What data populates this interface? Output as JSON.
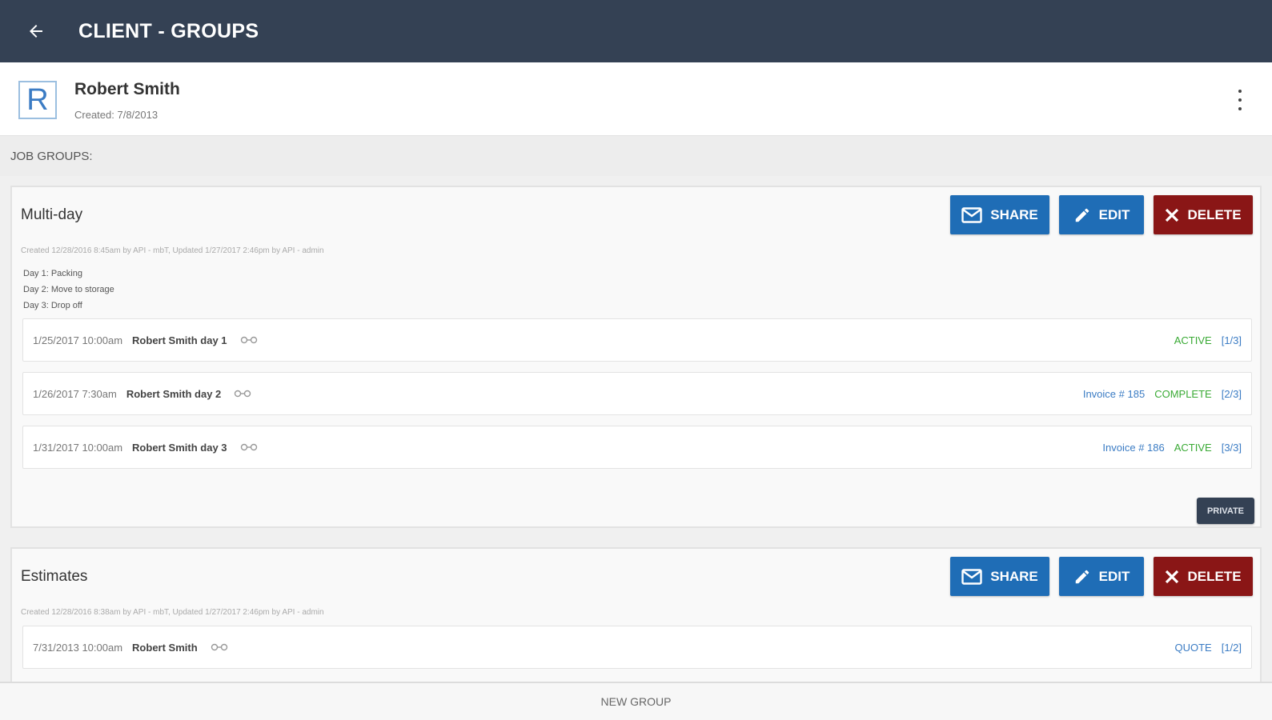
{
  "header": {
    "title": "CLIENT - GROUPS",
    "back_icon": "arrow-left-icon"
  },
  "client": {
    "initial": "R",
    "name": "Robert Smith",
    "created": "Created: 7/8/2013",
    "menu_icon": "more-vertical-icon"
  },
  "section_label": "JOB GROUPS:",
  "buttons": {
    "share": "SHARE",
    "edit": "EDIT",
    "delete": "DELETE"
  },
  "groups": [
    {
      "title": "Multi-day",
      "meta": "Created 12/28/2016 8:45am by API - mbT, Updated 1/27/2017 2:46pm by API - admin",
      "description": [
        "Day 1: Packing",
        "Day 2: Move to storage",
        "Day 3: Drop off"
      ],
      "jobs": [
        {
          "date": "1/25/2017 10:00am",
          "name": "Robert Smith day 1",
          "invoice": "",
          "status": "ACTIVE",
          "count": "[1/3]"
        },
        {
          "date": "1/26/2017 7:30am",
          "name": "Robert Smith day 2",
          "invoice": "Invoice # 185",
          "status": "COMPLETE",
          "count": "[2/3]"
        },
        {
          "date": "1/31/2017 10:00am",
          "name": "Robert Smith day 3",
          "invoice": "Invoice # 186",
          "status": "ACTIVE",
          "count": "[3/3]"
        }
      ],
      "badge": "PRIVATE"
    },
    {
      "title": "Estimates",
      "meta": "Created 12/28/2016 8:38am by API - mbT, Updated 1/27/2017 2:46pm by API - admin",
      "jobs": [
        {
          "date": "7/31/2013 10:00am",
          "name": "Robert Smith",
          "invoice": "",
          "status": "QUOTE",
          "count": "[1/2]"
        }
      ]
    }
  ],
  "footer": {
    "new_group": "NEW GROUP"
  },
  "colors": {
    "topbar": "#344154",
    "primary": "#1f6db6",
    "danger": "#8a1616",
    "status_active": "#3aaa35",
    "status_complete": "#3aaa35",
    "status_quote": "#3b7cc4"
  }
}
